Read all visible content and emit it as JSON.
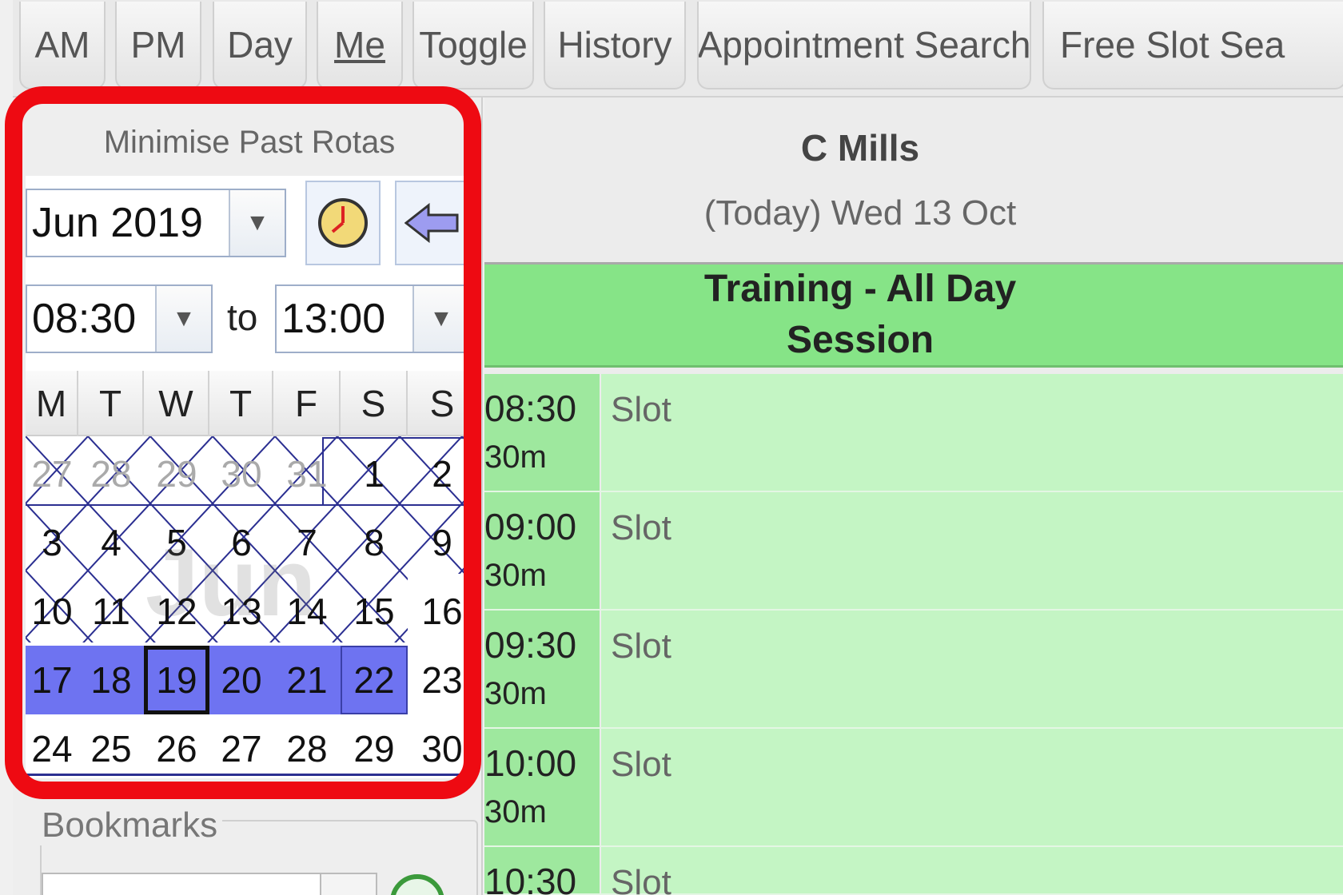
{
  "toolbar": {
    "tabs": [
      "AM",
      "PM",
      "Day",
      "Me",
      "Toggle",
      "History",
      "Appointment Search",
      "Free Slot Sea"
    ]
  },
  "left_panel": {
    "minimise_label": "Minimise Past Rotas",
    "month_value": "Jun 2019",
    "time_from": "08:30",
    "to_label": "to",
    "time_to": "13:00",
    "calendar": {
      "day_headers": [
        "M",
        "T",
        "W",
        "T",
        "F",
        "S",
        "S"
      ],
      "weeks": [
        [
          "27",
          "28",
          "29",
          "30",
          "31",
          "1",
          "2"
        ],
        [
          "3",
          "4",
          "5",
          "6",
          "7",
          "8",
          "9"
        ],
        [
          "10",
          "11",
          "12",
          "13",
          "14",
          "15",
          "16"
        ],
        [
          "17",
          "18",
          "19",
          "20",
          "21",
          "22",
          "23"
        ],
        [
          "24",
          "25",
          "26",
          "27",
          "28",
          "29",
          "30"
        ]
      ],
      "selected_week_days": [
        "17",
        "18",
        "19",
        "20",
        "21",
        "22"
      ],
      "current_day": "19",
      "watermark": "Jun"
    },
    "bookmarks_label": "Bookmarks"
  },
  "right_panel": {
    "clinician": "C Mills",
    "date": "(Today) Wed 13 Oct",
    "session_line1": "Training - All Day",
    "session_line2": "Session",
    "slots": [
      {
        "time": "08:30",
        "duration": "30m",
        "label": "Slot"
      },
      {
        "time": "09:00",
        "duration": "30m",
        "label": "Slot"
      },
      {
        "time": "09:30",
        "duration": "30m",
        "label": "Slot"
      },
      {
        "time": "10:00",
        "duration": "30m",
        "label": "Slot"
      },
      {
        "time": "10:30",
        "duration": "",
        "label": "Slot"
      }
    ]
  },
  "colors": {
    "highlight": "#ee0a12",
    "selected_week": "#6e73f1",
    "session_header": "#86e487",
    "slot_time": "#9ee89e",
    "slot_body": "#c4f5c4"
  }
}
